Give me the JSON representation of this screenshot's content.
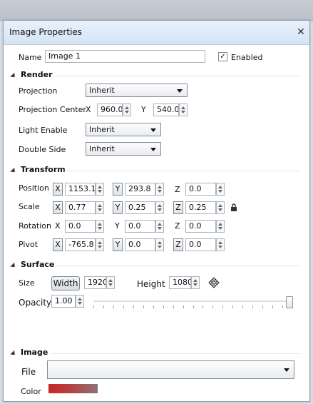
{
  "window": {
    "title": "Image Properties",
    "close": "✕"
  },
  "general": {
    "name_label": "Name",
    "name_value": "Image 1",
    "enabled_label": "Enabled",
    "enabled_checked": "✓"
  },
  "render": {
    "section": "Render",
    "projection_label": "Projection",
    "projection_value": "Inherit",
    "projection_center_label": "Projection Center",
    "pc_x_label": "X",
    "pc_x_value": "960.0",
    "pc_y_label": "Y",
    "pc_y_value": "540.0",
    "light_enable_label": "Light Enable",
    "light_enable_value": "Inherit",
    "double_side_label": "Double Side",
    "double_side_value": "Inherit"
  },
  "transform": {
    "section": "Transform",
    "position_label": "Position",
    "position_x": "1153.1",
    "position_y": "293.8",
    "position_z": "0.0",
    "scale_label": "Scale",
    "scale_x": "0.77",
    "scale_y": "0.25",
    "scale_z": "0.25",
    "rotation_label": "Rotation",
    "rotation_x": "0.0",
    "rotation_y": "0.0",
    "rotation_z": "0.0",
    "pivot_label": "Pivot",
    "pivot_x": "-765.8",
    "pivot_y": "0.0",
    "pivot_z": "0.0",
    "x_label": "X",
    "y_label": "Y",
    "z_label": "Z"
  },
  "surface": {
    "section": "Surface",
    "size_label": "Size",
    "width_button": "Width",
    "width_value": "1920",
    "height_label": "Height",
    "height_value": "1080",
    "opacity_label": "Opacity",
    "opacity_value": "1.00",
    "opacity_level": 1.0
  },
  "image": {
    "section": "Image",
    "file_label": "File",
    "file_value": "",
    "color_label": "Color"
  },
  "icons": {
    "lock": "lock-icon",
    "expand_triangle": "triangle-icon",
    "resize_cursor": "resize-icon"
  }
}
